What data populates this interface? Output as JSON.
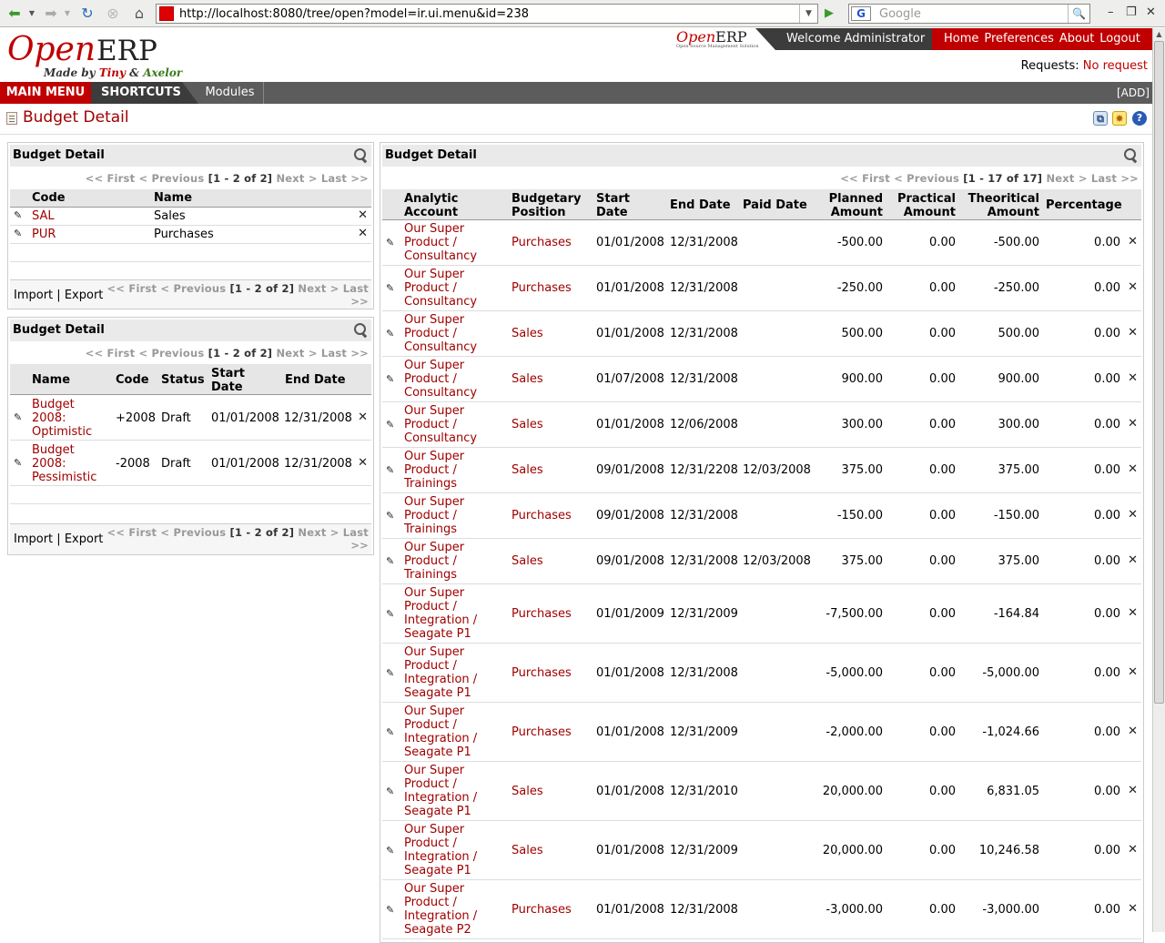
{
  "browser": {
    "url": "http://localhost:8080/tree/open?model=ir.ui.menu&id=238",
    "search_placeholder": "Google",
    "search_engine": "G"
  },
  "header": {
    "logo_open": "Open",
    "logo_erp": "ERP",
    "logo_tagline_prefix": "Made by ",
    "logo_tagline_tiny": "Tiny",
    "logo_tagline_amp": " & ",
    "logo_tagline_axelor": "Axelor",
    "mini_logo_open": "Open",
    "mini_logo_erp": "ERP",
    "mini_logo_tag": "Open Source Management Solution",
    "welcome": "Welcome Administrator",
    "links": [
      "Home",
      "Preferences",
      "About",
      "Logout"
    ],
    "requests_label": "Requests:",
    "requests_value": "No request"
  },
  "menubar": {
    "main_menu": "MAIN MENU",
    "shortcuts": "SHORTCUTS",
    "modules": "Modules",
    "add": "[ADD]"
  },
  "page": {
    "title": "Budget Detail"
  },
  "positions_panel": {
    "title": "Budget Detail",
    "pager": {
      "first": "<< First",
      "prev": "< Previous",
      "count": "[1 - 2 of 2]",
      "next": "Next >",
      "last": "Last >>"
    },
    "columns": [
      "Code",
      "Name"
    ],
    "rows": [
      {
        "code": "SAL",
        "name": "Sales"
      },
      {
        "code": "PUR",
        "name": "Purchases"
      }
    ],
    "import": "Import",
    "sep": "|",
    "export": "Export",
    "footer_pager_line1": "<< First < Previous",
    "footer_pager_line2": "Next > Last",
    "footer_pager_line3": ">>"
  },
  "budgets_panel": {
    "title": "Budget Detail",
    "pager": {
      "first": "<< First",
      "prev": "< Previous",
      "count": "[1 - 2 of 2]",
      "next": "Next >",
      "last": "Last >>"
    },
    "columns": [
      "Name",
      "Code",
      "Status",
      "Start Date",
      "End Date"
    ],
    "rows": [
      {
        "name": "Budget 2008: Optimistic",
        "code": "+2008",
        "status": "Draft",
        "start": "01/01/2008",
        "end": "12/31/2008"
      },
      {
        "name": "Budget 2008: Pessimistic",
        "code": "-2008",
        "status": "Draft",
        "start": "01/01/2008",
        "end": "12/31/2008"
      }
    ],
    "import": "Import",
    "sep": "|",
    "export": "Export",
    "footer_pager_line1": "<< First < Previous",
    "footer_pager_line2": "Next > Last",
    "footer_pager_line3": ">>"
  },
  "lines_panel": {
    "title": "Budget Detail",
    "pager": {
      "first": "<< First",
      "prev": "< Previous",
      "count": "[1 - 17 of 17]",
      "next": "Next >",
      "last": "Last >>"
    },
    "columns": [
      "Analytic Account",
      "Budgetary Position",
      "Start Date",
      "End Date",
      "Paid Date",
      "Planned Amount",
      "Practical Amount",
      "Theoritical Amount",
      "Percentage"
    ],
    "rows": [
      {
        "account": "Our Super Product / Consultancy",
        "position": "Purchases",
        "start": "01/01/2008",
        "end": "12/31/2008",
        "paid": "",
        "planned": "-500.00",
        "practical": "0.00",
        "theoretical": "-500.00",
        "pct": "0.00"
      },
      {
        "account": "Our Super Product / Consultancy",
        "position": "Purchases",
        "start": "01/01/2008",
        "end": "12/31/2008",
        "paid": "",
        "planned": "-250.00",
        "practical": "0.00",
        "theoretical": "-250.00",
        "pct": "0.00"
      },
      {
        "account": "Our Super Product / Consultancy",
        "position": "Sales",
        "start": "01/01/2008",
        "end": "12/31/2008",
        "paid": "",
        "planned": "500.00",
        "practical": "0.00",
        "theoretical": "500.00",
        "pct": "0.00"
      },
      {
        "account": "Our Super Product / Consultancy",
        "position": "Sales",
        "start": "01/07/2008",
        "end": "12/31/2008",
        "paid": "",
        "planned": "900.00",
        "practical": "0.00",
        "theoretical": "900.00",
        "pct": "0.00"
      },
      {
        "account": "Our Super Product / Consultancy",
        "position": "Sales",
        "start": "01/01/2008",
        "end": "12/06/2008",
        "paid": "",
        "planned": "300.00",
        "practical": "0.00",
        "theoretical": "300.00",
        "pct": "0.00"
      },
      {
        "account": "Our Super Product / Trainings",
        "position": "Sales",
        "start": "09/01/2008",
        "end": "12/31/2208",
        "paid": "12/03/2008",
        "planned": "375.00",
        "practical": "0.00",
        "theoretical": "375.00",
        "pct": "0.00"
      },
      {
        "account": "Our Super Product / Trainings",
        "position": "Purchases",
        "start": "09/01/2008",
        "end": "12/31/2008",
        "paid": "",
        "planned": "-150.00",
        "practical": "0.00",
        "theoretical": "-150.00",
        "pct": "0.00"
      },
      {
        "account": "Our Super Product / Trainings",
        "position": "Sales",
        "start": "09/01/2008",
        "end": "12/31/2008",
        "paid": "12/03/2008",
        "planned": "375.00",
        "practical": "0.00",
        "theoretical": "375.00",
        "pct": "0.00"
      },
      {
        "account": "Our Super Product / Integration / Seagate P1",
        "position": "Purchases",
        "start": "01/01/2009",
        "end": "12/31/2009",
        "paid": "",
        "planned": "-7,500.00",
        "practical": "0.00",
        "theoretical": "-164.84",
        "pct": "0.00"
      },
      {
        "account": "Our Super Product / Integration / Seagate P1",
        "position": "Purchases",
        "start": "01/01/2008",
        "end": "12/31/2008",
        "paid": "",
        "planned": "-5,000.00",
        "practical": "0.00",
        "theoretical": "-5,000.00",
        "pct": "0.00"
      },
      {
        "account": "Our Super Product / Integration / Seagate P1",
        "position": "Purchases",
        "start": "01/01/2008",
        "end": "12/31/2009",
        "paid": "",
        "planned": "-2,000.00",
        "practical": "0.00",
        "theoretical": "-1,024.66",
        "pct": "0.00"
      },
      {
        "account": "Our Super Product / Integration / Seagate P1",
        "position": "Sales",
        "start": "01/01/2008",
        "end": "12/31/2010",
        "paid": "",
        "planned": "20,000.00",
        "practical": "0.00",
        "theoretical": "6,831.05",
        "pct": "0.00"
      },
      {
        "account": "Our Super Product / Integration / Seagate P1",
        "position": "Sales",
        "start": "01/01/2008",
        "end": "12/31/2009",
        "paid": "",
        "planned": "20,000.00",
        "practical": "0.00",
        "theoretical": "10,246.58",
        "pct": "0.00"
      },
      {
        "account": "Our Super Product / Integration / Seagate P2",
        "position": "Purchases",
        "start": "01/01/2008",
        "end": "12/31/2008",
        "paid": "",
        "planned": "-3,000.00",
        "practical": "0.00",
        "theoretical": "-3,000.00",
        "pct": "0.00"
      }
    ]
  }
}
